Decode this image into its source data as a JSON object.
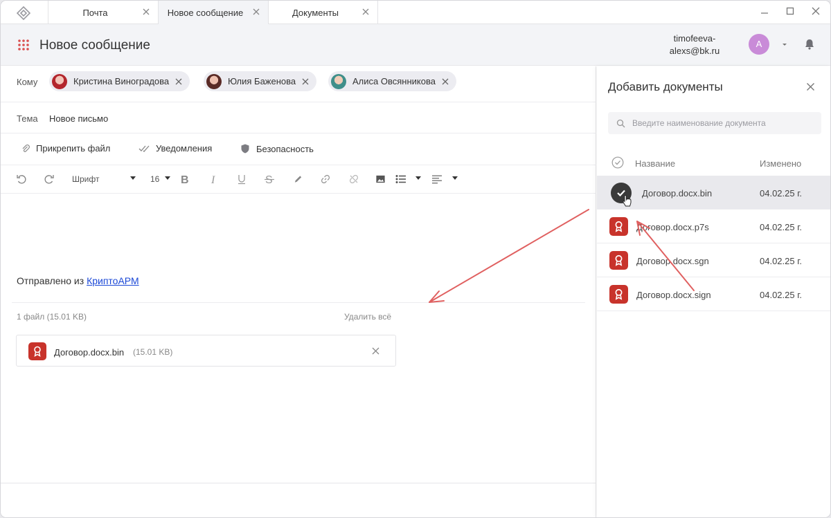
{
  "tabs": [
    {
      "label": "Почта"
    },
    {
      "label": "Новое сообщение",
      "active": true
    },
    {
      "label": "Документы"
    }
  ],
  "header": {
    "title": "Новое сообщение",
    "user_email_line1": "timofeeva-",
    "user_email_line2": "alexs@bk.ru",
    "avatar_initial": "A"
  },
  "compose": {
    "to_label": "Кому",
    "recipients": [
      {
        "name": "Кристина Виноградова"
      },
      {
        "name": "Юлия Баженова"
      },
      {
        "name": "Алиса Овсянникова"
      }
    ],
    "subject_label": "Тема",
    "subject_value": "Новое письмо",
    "actions": {
      "attach_file": "Прикрепить файл",
      "notifications": "Уведомления",
      "security": "Безопасность"
    },
    "toolbar": {
      "font": "Шрифт",
      "size": "16"
    },
    "signature_prefix": "Отправлено из",
    "signature_link": "КриптоАРМ",
    "files_count": "1 файл (15.01 KB)",
    "delete_all": "Удалить всё",
    "attached_file": {
      "name": "Договор.docx.bin",
      "size": "(15.01 KB)"
    }
  },
  "panel": {
    "title": "Добавить документы",
    "search_placeholder": "Введите наименование документа",
    "col_name": "Название",
    "col_date": "Изменено",
    "documents": [
      {
        "name": "Договор.docx.bin",
        "date": "04.02.25 г.",
        "selected": true
      },
      {
        "name": "Договор.docx.p7s",
        "date": "04.02.25 г."
      },
      {
        "name": "Договор.docx.sgn",
        "date": "04.02.25 г."
      },
      {
        "name": "Договор.docx.sign",
        "date": "04.02.25 г."
      }
    ]
  },
  "colors": {
    "accent_red": "#c8332b",
    "link_blue": "#1a47d6",
    "annotation_arrow": "#e06060",
    "avatar_bg": "#c98bd8"
  },
  "icons": [
    "app-logo-icon",
    "close-icon",
    "minimize-icon",
    "maximize-icon",
    "apps-grid-icon",
    "chevron-down-icon",
    "bell-icon",
    "paperclip-icon",
    "double-check-icon",
    "shield-icon",
    "undo-icon",
    "redo-icon",
    "bold-icon",
    "italic-icon",
    "underline-icon",
    "strikethrough-icon",
    "pen-icon",
    "link-icon",
    "unlink-icon",
    "image-icon",
    "list-icon",
    "align-icon",
    "search-icon",
    "check-circle-icon",
    "document-seal-icon",
    "cursor-hand-icon"
  ]
}
